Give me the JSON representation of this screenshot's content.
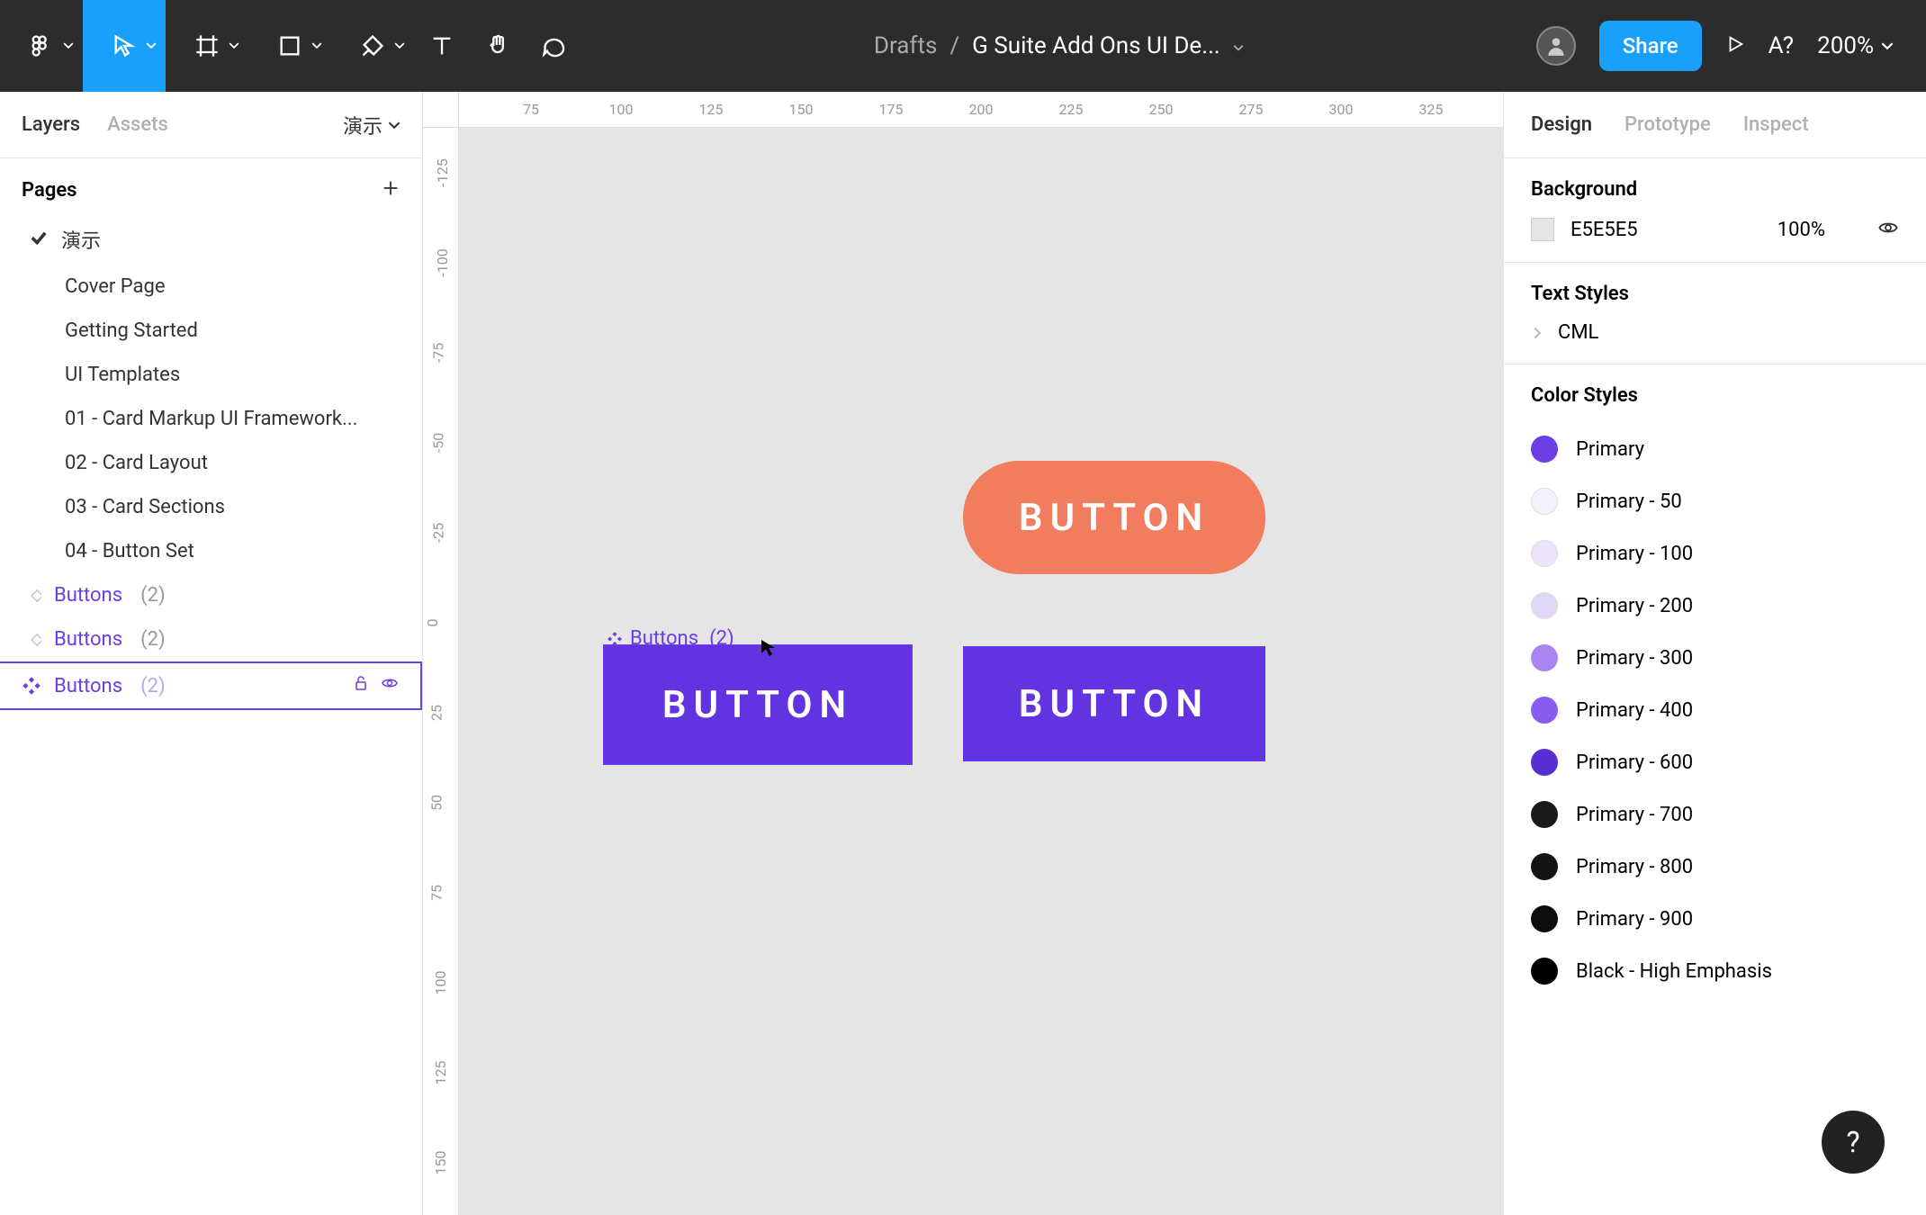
{
  "toolbar": {
    "breadcrumb_folder": "Drafts",
    "breadcrumb_sep": "/",
    "file_name": "G Suite Add Ons UI De...",
    "share_label": "Share",
    "font_indicator": "A?",
    "zoom": "200%"
  },
  "left_panel": {
    "tabs": {
      "layers": "Layers",
      "assets": "Assets",
      "page_indicator": "演示"
    },
    "pages_title": "Pages",
    "pages": [
      {
        "label": "演示",
        "current": true
      },
      {
        "label": "Cover Page"
      },
      {
        "label": "Getting Started"
      },
      {
        "label": "UI Templates"
      },
      {
        "label": "01 - Card Markup UI Framework..."
      },
      {
        "label": "02 - Card Layout"
      },
      {
        "label": "03 - Card Sections"
      },
      {
        "label": "04 - Button Set"
      }
    ],
    "layers": [
      {
        "name": "Buttons",
        "count": "(2)",
        "selected": false,
        "filled": false
      },
      {
        "name": "Buttons",
        "count": "(2)",
        "selected": false,
        "filled": false
      },
      {
        "name": "Buttons",
        "count": "(2)",
        "selected": true,
        "filled": true
      }
    ]
  },
  "canvas": {
    "ruler_h": [
      "75",
      "100",
      "125",
      "150",
      "175",
      "200",
      "225",
      "250",
      "275",
      "300",
      "325"
    ],
    "ruler_v": [
      "-125",
      "-100",
      "-75",
      "-50",
      "-25",
      "0",
      "25",
      "50",
      "75",
      "100",
      "125",
      "150"
    ],
    "label": {
      "name": "Buttons",
      "count": "(2)"
    },
    "button_text": "BUTTON"
  },
  "right_panel": {
    "tabs": {
      "design": "Design",
      "prototype": "Prototype",
      "inspect": "Inspect"
    },
    "background": {
      "title": "Background",
      "hex": "E5E5E5",
      "opacity": "100%"
    },
    "text_styles": {
      "title": "Text Styles",
      "items": [
        "CML"
      ]
    },
    "color_styles": {
      "title": "Color Styles",
      "items": [
        {
          "name": "Primary",
          "color": "#6b3ee6"
        },
        {
          "name": "Primary - 50",
          "color": "#f5f2fd"
        },
        {
          "name": "Primary - 100",
          "color": "#ebe4fb"
        },
        {
          "name": "Primary - 200",
          "color": "#e0d7f8"
        },
        {
          "name": "Primary - 300",
          "color": "#a985f3"
        },
        {
          "name": "Primary - 400",
          "color": "#8a5cef"
        },
        {
          "name": "Primary - 600",
          "color": "#5a2fd1"
        },
        {
          "name": "Primary - 700",
          "color": "#1a1a1a"
        },
        {
          "name": "Primary - 800",
          "color": "#141414"
        },
        {
          "name": "Primary - 900",
          "color": "#0d0d0d"
        },
        {
          "name": "Black - High Emphasis",
          "color": "#000000"
        }
      ]
    }
  },
  "fab": "?"
}
